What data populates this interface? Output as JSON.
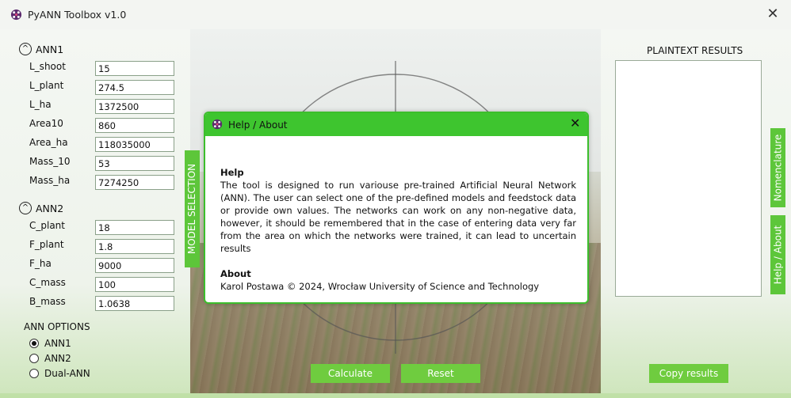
{
  "window": {
    "title": "PyANN Toolbox v1.0",
    "close_glyph": "✕",
    "icon": "pyann-app-icon"
  },
  "ann1": {
    "header": "ANN1",
    "fields": [
      {
        "label": "L_shoot",
        "value": "15"
      },
      {
        "label": "L_plant",
        "value": "274.5"
      },
      {
        "label": "L_ha",
        "value": "1372500"
      },
      {
        "label": "Area10",
        "value": "860"
      },
      {
        "label": "Area_ha",
        "value": "118035000"
      },
      {
        "label": "Mass_10",
        "value": "53"
      },
      {
        "label": "Mass_ha",
        "value": "7274250"
      }
    ]
  },
  "ann2": {
    "header": "ANN2",
    "fields": [
      {
        "label": "C_plant",
        "value": "18"
      },
      {
        "label": "F_plant",
        "value": "1.8"
      },
      {
        "label": "F_ha",
        "value": "9000"
      },
      {
        "label": "C_mass",
        "value": "100"
      },
      {
        "label": "B_mass",
        "value": "1.0638"
      }
    ]
  },
  "options": {
    "title": "ANN OPTIONS",
    "radios": [
      {
        "label": "ANN1",
        "selected": true
      },
      {
        "label": "ANN2",
        "selected": false
      },
      {
        "label": "Dual-ANN",
        "selected": false
      }
    ]
  },
  "tabs": {
    "model_selection": "MODEL SELECTION",
    "nomenclature": "Nomenclature",
    "help": "Help / About"
  },
  "buttons": {
    "calculate": "Calculate",
    "reset": "Reset",
    "copy": "Copy results"
  },
  "results": {
    "title": "PLAINTEXT RESULTS",
    "text": ""
  },
  "dialog": {
    "title": "Help / About",
    "close_glyph": "✕",
    "help_heading": "Help",
    "help_text": "The tool is designed to run variouse pre-trained Artificial Neural Network (ANN). The user can select one of the pre-defined models and feedstock data or provide own values. The networks can work on any non-negative data, however, it should be remembered that in the case of entering data very far from the area on which the networks were trained, it can lead to uncertain results",
    "about_heading": "About",
    "about_text": "Karol Postawa © 2024, Wrocław University of Science and Technology"
  },
  "colors": {
    "accent": "#5dc63a",
    "dialog_header": "#3ec52f",
    "button": "#6fcc3f"
  }
}
